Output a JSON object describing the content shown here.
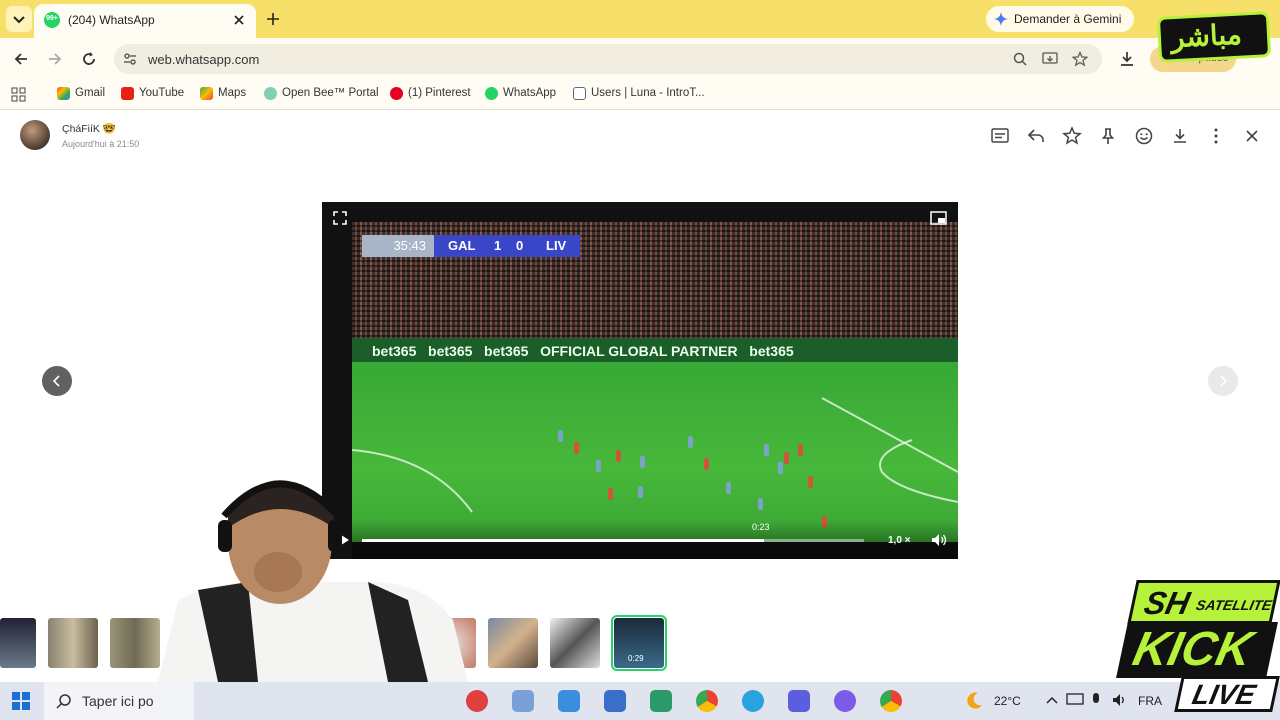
{
  "browser": {
    "tab_title": "(204) WhatsApp",
    "tab_badge": "99+",
    "gemini_label": "Demander à Gemini",
    "url": "web.whatsapp.com",
    "profile_status": "En pause",
    "bookmarks": [
      {
        "label": "Gmail",
        "icon": "gmail-icon"
      },
      {
        "label": "YouTube",
        "icon": "youtube-icon"
      },
      {
        "label": "Maps",
        "icon": "maps-icon"
      },
      {
        "label": "Open Bee™ Portal",
        "icon": "openbee-icon"
      },
      {
        "label": "(1) Pinterest",
        "icon": "pinterest-icon"
      },
      {
        "label": "WhatsApp",
        "icon": "whatsapp-icon"
      },
      {
        "label": "Users | Luna - IntroT...",
        "icon": "table-icon"
      }
    ]
  },
  "viewer": {
    "sender": "ÇháFiíK 🤓",
    "timestamp": "Aujourd'hui à 21:50",
    "toolbar_icons": [
      "caption-icon",
      "reply-icon",
      "star-icon",
      "pin-icon",
      "emoji-icon",
      "download-icon",
      "more-icon",
      "close-icon"
    ]
  },
  "video": {
    "match_clock": "35:43",
    "home_team": "GAL",
    "home_score": "1",
    "away_score": "0",
    "away_team": "LIV",
    "adboard": "bet365   bet365   bet365   OFFICIAL GLOBAL PARTNER   bet365",
    "current_time": "0:23",
    "progress": 0.8,
    "speed": "1,0 ×"
  },
  "thumbnail_duration": "0:29",
  "taskbar": {
    "search_placeholder": "Taper ici po",
    "weather": "22°C",
    "language": "FRA"
  },
  "overlays": {
    "live_channel": "مباشر",
    "brand_top": "SH",
    "brand_sub": "SATELLITE",
    "brand_kick": "KICK",
    "brand_live": "LIVE"
  },
  "colors": {
    "tabstrip": "#f7e06a",
    "whatsapp_green": "#25d366",
    "kick_green": "#b7f23a",
    "scoreboard_blue": "#3a46c8"
  }
}
